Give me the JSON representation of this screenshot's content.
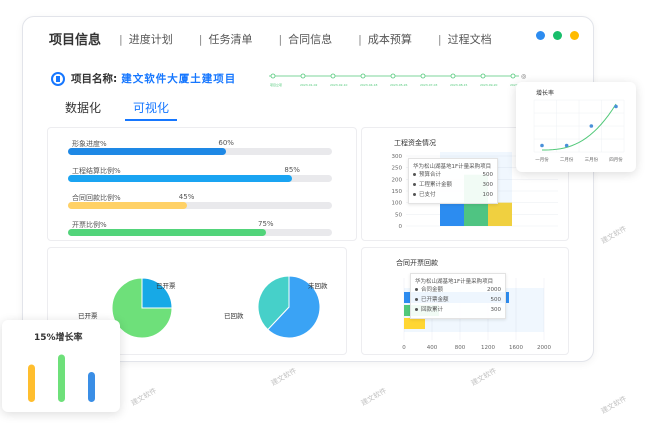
{
  "tabs": [
    "项目信息",
    "进度计划",
    "任务清单",
    "合同信息",
    "成本预算",
    "过程文档"
  ],
  "window_dots": [
    "#2d8cf0",
    "#19be6b",
    "#ffbb00"
  ],
  "project": {
    "label": "项目名称:",
    "name": "建文软件大厦土建项目"
  },
  "timeline": {
    "count": 9,
    "labels": [
      "项目立项",
      "2023-01-02",
      "2023-02-10",
      "2023-04-18",
      "2023-05-26",
      "2023-07-03",
      "2023-08-15",
      "2023-09-20",
      "2023-10-30"
    ],
    "end_marker": "◎",
    "end_label": "2"
  },
  "subtabs": [
    "数据化",
    "可视化"
  ],
  "progress": [
    {
      "label": "形象进度%",
      "pct": 60,
      "pct_text": "60%",
      "color": "#1e88e5"
    },
    {
      "label": "工程结算比例%",
      "pct": 85,
      "pct_text": "85%",
      "color": "#1aa4f2"
    },
    {
      "label": "合同回款比例%",
      "pct": 45,
      "pct_text": "45%",
      "color": "#ffd166"
    },
    {
      "label": "开票比例%",
      "pct": 75,
      "pct_text": "75%",
      "color": "#52d47a"
    }
  ],
  "bar_chart": {
    "title": "工程资金情况",
    "y_ticks": [
      "300",
      "250",
      "200",
      "150",
      "100",
      "50",
      "0"
    ],
    "tooltip": {
      "title": "华为松山湖基地1F计量采购项目",
      "rows": [
        [
          "预算合计",
          "500"
        ],
        [
          "工程累计金额",
          "300"
        ],
        [
          "已支付",
          "100"
        ]
      ]
    },
    "colors": [
      "#2d8cf0",
      "#52c97a",
      "#ffd633"
    ],
    "values": [
      100,
      220,
      100
    ]
  },
  "pie_left": {
    "labels": [
      "已开票",
      "已开票"
    ],
    "colors": [
      "#17a9e6",
      "#6ee07a"
    ],
    "values": [
      25,
      75
    ]
  },
  "pie_right": {
    "labels": [
      "未回款",
      "已回款"
    ],
    "colors": [
      "#3aa3f5",
      "#46d0c9"
    ],
    "values": [
      62,
      38
    ]
  },
  "hbar_chart": {
    "title": "合同开票回款",
    "x_ticks": [
      "0",
      "400",
      "800",
      "1200",
      "1600",
      "2000"
    ],
    "tooltip": {
      "title": "华为松山湖基地1F计量采购项目",
      "rows": [
        [
          "合同金额",
          "2000"
        ],
        [
          "已开票金额",
          "500"
        ],
        [
          "回款累计",
          "300"
        ]
      ]
    },
    "colors": [
      "#2d8cf0",
      "#52c97a",
      "#ffd633"
    ],
    "values": [
      1500,
      500,
      300
    ]
  },
  "float_growth": {
    "title": "增长率",
    "x_labels": [
      "一月份",
      "二月份",
      "三月份",
      "四月份"
    ],
    "points": [
      0.05,
      0.05,
      0.2,
      0.35
    ],
    "curve_color": "#52c97a",
    "point_color": "#4a90d9"
  },
  "float_bars": {
    "title": "15%增长率",
    "bars": [
      {
        "value": 0.75,
        "color": "#ffbe2e"
      },
      {
        "value": 0.95,
        "color": "#6ee07a"
      },
      {
        "value": 0.6,
        "color": "#3a8ee6"
      }
    ]
  },
  "watermark": "建文软件"
}
